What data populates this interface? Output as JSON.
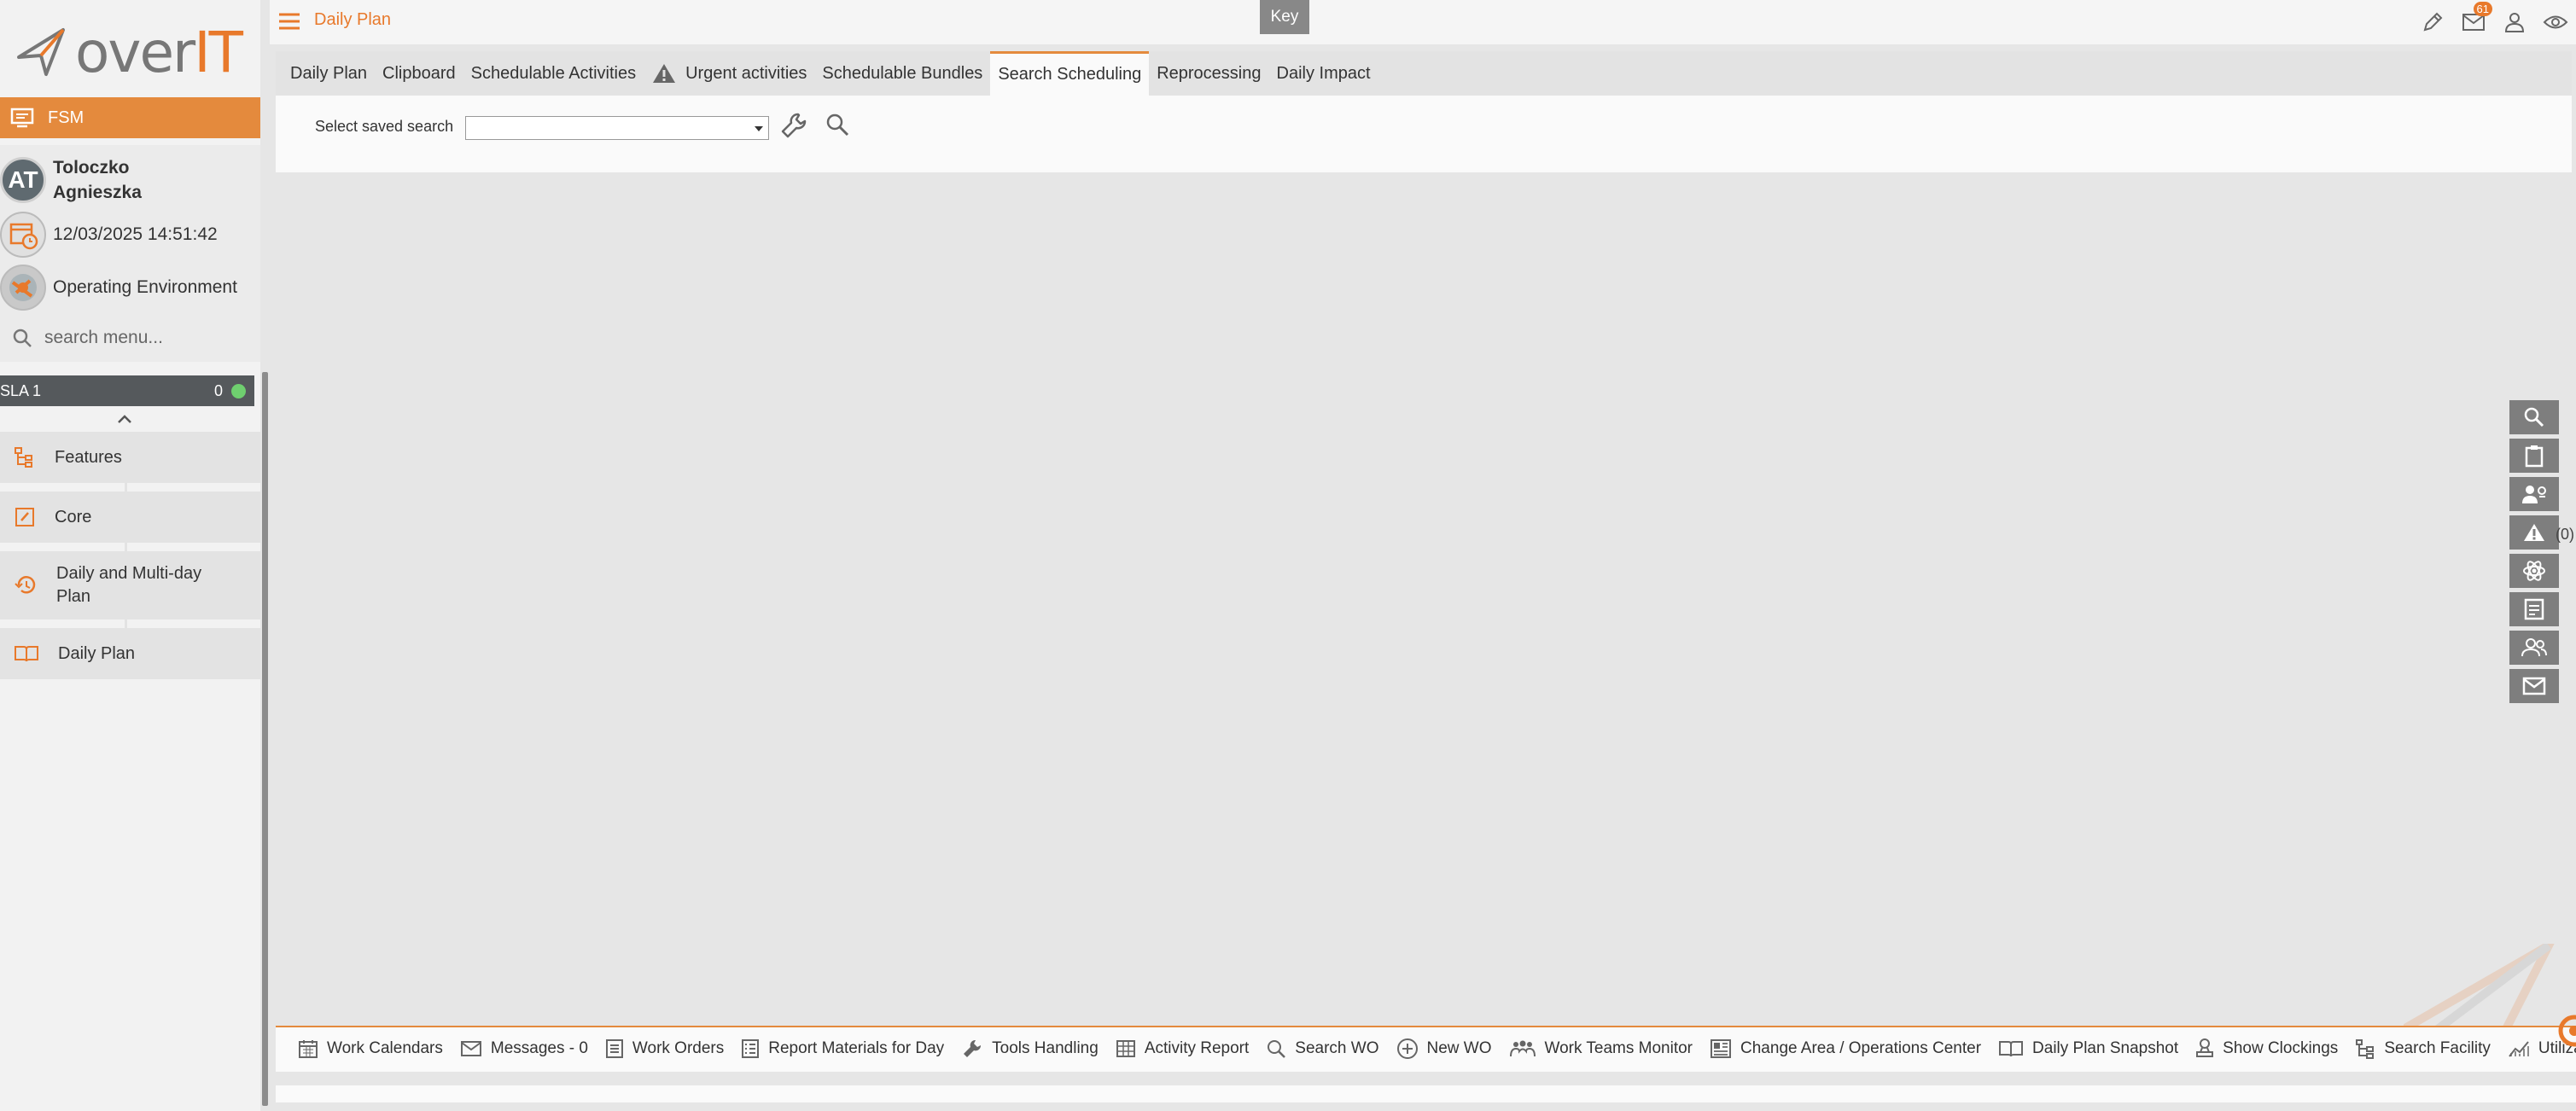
{
  "logo": {
    "over": "over",
    "it": "IT"
  },
  "sidebar": {
    "module": "FSM",
    "user": {
      "initials": "AT",
      "first_line": "Toloczko",
      "second_line": "Agnieszka"
    },
    "datetime": "12/03/2025 14:51:42",
    "environment": "Operating Environment",
    "search_placeholder": "search menu...",
    "sla": {
      "label": "SLA 1",
      "count": "0"
    },
    "items": [
      {
        "label": "Features",
        "icon": "hierarchy-icon"
      },
      {
        "label": "Core",
        "icon": "edit-checklist-icon"
      },
      {
        "label": "Daily and Multi-day Plan",
        "icon": "history-icon"
      },
      {
        "label": "Daily Plan",
        "icon": "book-icon"
      }
    ]
  },
  "header": {
    "title": "Daily Plan",
    "key_button": "Key",
    "notification_count": "61"
  },
  "tabs": [
    {
      "label": "Daily Plan",
      "active": false
    },
    {
      "label": "Clipboard",
      "active": false
    },
    {
      "label": "Schedulable Activities",
      "active": false
    },
    {
      "label": "Urgent activities",
      "active": false,
      "icon": "warning-icon"
    },
    {
      "label": "Schedulable Bundles",
      "active": false
    },
    {
      "label": "Search Scheduling",
      "active": true
    },
    {
      "label": "Reprocessing",
      "active": false
    },
    {
      "label": "Daily Impact",
      "active": false
    }
  ],
  "search_panel": {
    "label": "Select saved search",
    "selected_value": ""
  },
  "right_toolbar": {
    "urgent_count": "(0)",
    "buttons": [
      "search-icon",
      "clipboard-icon",
      "user-settings-icon",
      "warning-icon",
      "atom-icon",
      "report-icon",
      "team-icon",
      "mail-icon"
    ]
  },
  "bottom_bar": [
    {
      "label": "Work Calendars",
      "icon": "calendar-icon"
    },
    {
      "label": "Messages - 0",
      "icon": "mail-icon"
    },
    {
      "label": "Work Orders",
      "icon": "list-icon"
    },
    {
      "label": "Report Materials for Day",
      "icon": "checklist-icon"
    },
    {
      "label": "Tools Handling",
      "icon": "wrench-icon"
    },
    {
      "label": "Activity Report",
      "icon": "table-icon"
    },
    {
      "label": "Search WO",
      "icon": "search-icon"
    },
    {
      "label": "New WO",
      "icon": "plus-circle-icon"
    },
    {
      "label": "Work Teams Monitor",
      "icon": "team-icon"
    },
    {
      "label": "Change Area / Operations Center",
      "icon": "dashboard-icon"
    },
    {
      "label": "Daily Plan Snapshot",
      "icon": "book-icon"
    },
    {
      "label": "Show Clockings",
      "icon": "stamp-icon"
    },
    {
      "label": "Search Facility",
      "icon": "hierarchy-icon"
    },
    {
      "label": "Utilization Dashboard",
      "icon": "chart-icon"
    }
  ],
  "colors": {
    "accent": "#e48a3d",
    "brand_orange": "#e8792b",
    "dark": "#55595c",
    "status_ok": "#6fcf6f"
  }
}
